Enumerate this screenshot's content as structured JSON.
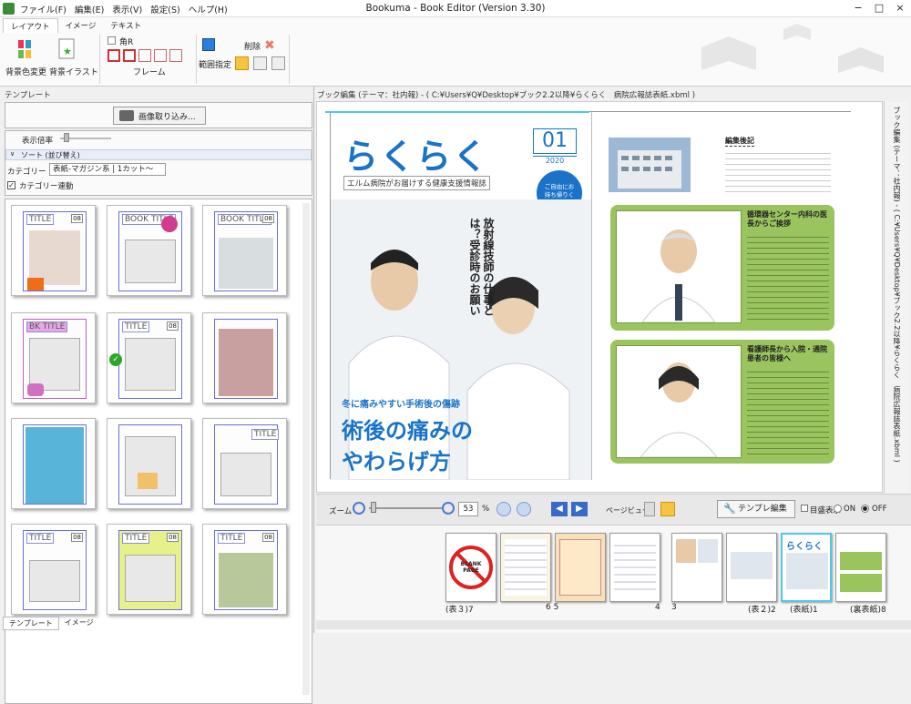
{
  "window": {
    "title": "Bookuma - Book Editor (Version 3.30)",
    "menu": [
      "ファイル(F)",
      "編集(E)",
      "表示(V)",
      "設定(S)",
      "ヘルプ(H)"
    ],
    "controls": {
      "minimize": "−",
      "maximize": "□",
      "close": "×"
    }
  },
  "ribbon": {
    "tabs": [
      "レイアウト",
      "イメージ",
      "テキスト"
    ],
    "bg_color_label": "背景色変更",
    "bg_illust_label": "背景イラスト",
    "corner_label": "角R",
    "frame_label": "フレーム",
    "range_label": "範囲指定",
    "delete_label": "削除"
  },
  "left": {
    "header": "テンプレート",
    "import_button": "画像取り込み...",
    "zoom_label": "表示倍率",
    "sort_label": "ソート (並び替え)",
    "category_label": "カテゴリー",
    "category_value": "表紙-マガジン系 | 1カット〜",
    "category_link_label": "カテゴリー連動",
    "bottom_tabs": [
      "テンプレート",
      "イメージ"
    ],
    "thumbs": [
      {
        "title": "TITLE",
        "num": "08"
      },
      {
        "title": "BOOK TITLE",
        "num": ""
      },
      {
        "title": "BOOK TITLE",
        "num": "08"
      },
      {
        "title": "BK TITLE",
        "num": ""
      },
      {
        "title": "TITLE",
        "num": "08"
      },
      {
        "title": "",
        "num": ""
      },
      {
        "title": "",
        "num": ""
      },
      {
        "title": "",
        "num": ""
      },
      {
        "title": "TITLE",
        "num": ""
      },
      {
        "title": "TITLE",
        "num": "08"
      },
      {
        "title": "TITLE",
        "num": "08"
      },
      {
        "title": "TITLE",
        "num": "08"
      }
    ]
  },
  "editor": {
    "header": "ブック編集 (テーマ：社内報) - ( C:¥Users¥Q¥Desktop¥ブック2.2以降¥らくらく　病院広報誌表紙.xbml )",
    "vertical_tab": "ブック編集 (テーマ：社内報) - ( C:¥Users¥Q¥Desktop¥ブック2.2以降¥らくらく　病院広報誌表紙.xbml )"
  },
  "page": {
    "masthead": "らくらく",
    "issue": "01",
    "year": "2020",
    "subtitle": "エルム病院がお届けする健康支援情報誌",
    "badge": "ご自由にお持ち帰りください",
    "vertical_headline": "放射線技師の仕事とは？受診時のお願い",
    "small_headline": "冬に痛みやすい手術後の傷跡",
    "big_headline_1": "術後の痛みの",
    "big_headline_2": "やわらげ方",
    "editor_note_title": "編集後記",
    "card1_title": "循環器センター内科の医長からご挨拶",
    "card2_title": "看護師長から入院・通院患者の皆様へ"
  },
  "zoombar": {
    "zoom_label": "ズーム",
    "zoom_value": "53",
    "zoom_unit": "%",
    "page_view_label": "ページビュー",
    "template_edit": "テンプレ編集",
    "spread_label": "目盛表示",
    "on_label": "ON",
    "off_label": "OFF"
  },
  "strip": {
    "labels": [
      "(表３)7",
      "6 5",
      "4",
      "3",
      "(表２)2",
      "(表紙)1",
      "(裏表紙)8"
    ],
    "blank_text": "BLANK PAGE"
  },
  "colors": {
    "accent_blue": "#1a73c9",
    "green_card": "#9ac45e",
    "cyan": "#4fc8e8"
  }
}
